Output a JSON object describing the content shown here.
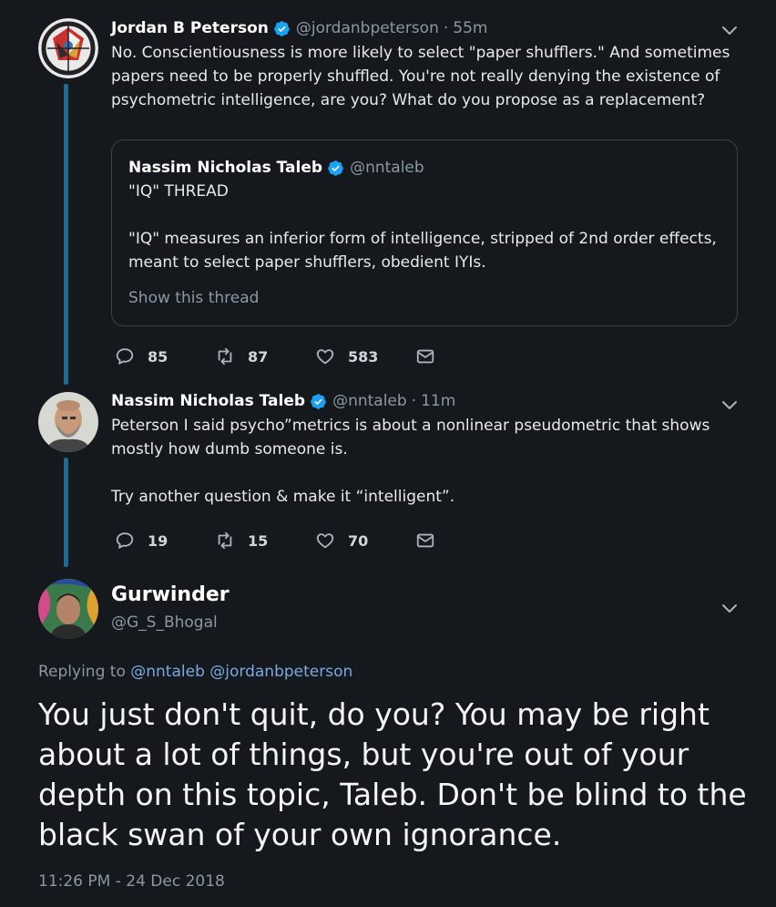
{
  "tweet1": {
    "name": "Jordan B Peterson",
    "handle": "@jordanbpeterson",
    "time": "55m",
    "text": "No. Conscientiousness is more likely to select \"paper shufflers.\" And sometimes papers need to be properly shuffled. You're not really denying the existence of psychometric intelligence, are you? What do you propose as a replacement?",
    "quote": {
      "name": "Nassim Nicholas Taleb",
      "handle": "@nntaleb",
      "text": "\"IQ\" THREAD\n\n\"IQ\" measures an inferior form of intelligence, stripped of 2nd order effects, meant to select paper shufflers, obedient IYIs.",
      "show_thread": "Show this thread"
    },
    "replies": "85",
    "retweets": "87",
    "likes": "583"
  },
  "tweet2": {
    "name": "Nassim Nicholas Taleb",
    "handle": "@nntaleb",
    "time": "11m",
    "text": "Peterson I said psycho”metrics is about a nonlinear pseudometric that shows mostly how dumb someone is.\n\nTry another question & make it “intelligent”.",
    "replies": "19",
    "retweets": "15",
    "likes": "70"
  },
  "main_tweet": {
    "name": "Gurwinder",
    "handle": "@G_S_Bhogal",
    "replying_label": "Replying to",
    "reply_to_1": "@nntaleb",
    "reply_to_2": "@jordanbpeterson",
    "text": "You just don't quit, do you? You may be right about a lot of things, but you're out of your depth on this topic, Taleb. Don't be blind to the black swan of your own ignorance.",
    "timestamp": "11:26 PM - 24 Dec 2018"
  },
  "colors": {
    "background": "#15181c",
    "thread_line": "#1d6a96",
    "verified": "#1da1f2",
    "link": "#7aa9df",
    "muted": "#8b98a5"
  }
}
